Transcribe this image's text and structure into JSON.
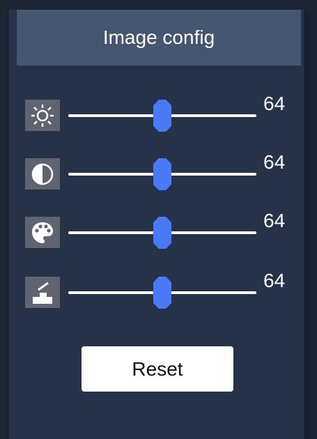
{
  "window": {
    "title": "Image config"
  },
  "sliders": [
    {
      "id": "brightness",
      "icon": "brightness-icon",
      "value": "64",
      "level": 0.5
    },
    {
      "id": "contrast",
      "icon": "contrast-icon",
      "value": "64",
      "level": 0.5
    },
    {
      "id": "saturation",
      "icon": "palette-icon",
      "value": "64",
      "level": 0.5
    },
    {
      "id": "sharpness",
      "icon": "sharpness-icon",
      "value": "64",
      "level": 0.5
    }
  ],
  "buttons": {
    "reset_label": "Reset"
  },
  "colors": {
    "accent": "#4a79f5",
    "header_bg": "#465570",
    "panel_bg": "#263248"
  }
}
